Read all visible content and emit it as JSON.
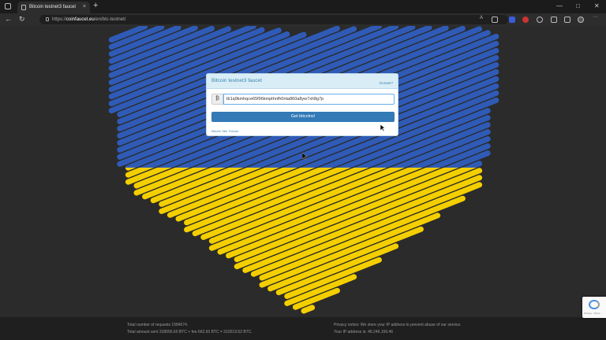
{
  "browser": {
    "tab_title": "Bitcoin testnet3 faucet",
    "tab_close": "×",
    "new_tab": "+",
    "url_prefix": "https://",
    "url_host": "coinfaucet.eu",
    "url_path": "/en/btc-testnet/",
    "controls": {
      "minimize": "—",
      "maximize": "□",
      "close": "✕"
    }
  },
  "nav": {
    "back": "←",
    "reload": "↻"
  },
  "faucet": {
    "title": "Bitcoin testnet3 faucet",
    "donate_link": "Donate?",
    "currency_symbol": "₿",
    "address_value": "tb1q9kmhqce65f96kmpthnfh0nta860a8yw7xh8g7p",
    "submit_label": "Get bitcoins!",
    "thread_link": "Bitcoin Talk Thread"
  },
  "flag_colors": {
    "blue": "#2f5bb7",
    "yellow": "#f4cf00"
  },
  "footer": {
    "requests_line": "Total number of requests 1584674.",
    "amount_line": "Total amount sent 318556.60 BTC + fee 662.93 BTC = 319219.52 BTC.",
    "privacy_line": "Privacy notice: We store your IP address to prevent abuse of our service.",
    "ip_line": "Your IP address is: 46.246.106.46"
  },
  "recaptcha": {
    "label": "Privacy - Terms"
  }
}
